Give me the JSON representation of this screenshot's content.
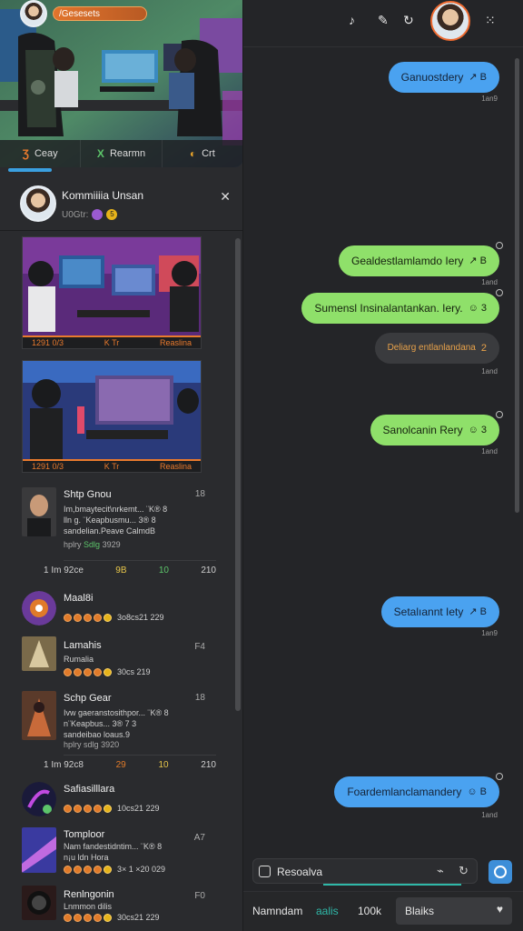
{
  "hero": {
    "pill_label": "/Gesesets",
    "tabs": [
      {
        "icon": "Ʒ",
        "label": "Ceay"
      },
      {
        "icon": "X",
        "label": "Rearmn"
      },
      {
        "icon": "◐",
        "label": "Crt"
      }
    ]
  },
  "profile": {
    "name": "Kommiiiia Unsan",
    "sub": "U0Gtr:",
    "badge": "5"
  },
  "media": [
    {
      "left": "1291 0/3",
      "mid": "K Tr",
      "right": "Reaslina"
    },
    {
      "left": "1291 0/3",
      "mid": "K Tr",
      "right": "Reaslina"
    }
  ],
  "posts": [
    {
      "title": "Shtp Gnou",
      "time": "18",
      "lines": [
        "Im,bmaytecit\\nrkemt... ¨K® 8",
        "lln g. ¨Keapbusmu... 3® 8",
        "sandelian.Peave CalmdB"
      ],
      "meta_a": "hplry",
      "meta_b": "Sdlg",
      "meta_c": "3929",
      "stats": [
        "1 Im 92ce",
        "9B",
        "10",
        "210"
      ]
    },
    {
      "title": "Schp Gear",
      "time": "18",
      "lines": [
        "Ivw gaeranstosithpor... ¨K® 8",
        "n¨Keapbus... 3® 7 3",
        "sandeibao loaus.9"
      ],
      "meta_a": "hplry",
      "meta_b": "sdlg",
      "meta_c": "3920",
      "stats": [
        "1 Im 92c8",
        "29",
        "10",
        "210"
      ]
    }
  ],
  "list": [
    {
      "title": "Maal8i",
      "sub": "3o8cs21 229",
      "time": ""
    },
    {
      "title": "Lamahis",
      "sub2": "Rumalia",
      "sub": "30cs 219",
      "time": "F4"
    },
    {
      "title": "Safiasilllara",
      "sub": "10cs21 229",
      "time": ""
    },
    {
      "title": "Tomploor",
      "sub2": "Nam fandestidntim... ¨K® 8",
      "sub3": "n¡u ldn Hora",
      "sub": "3× 1 ×20 029",
      "time": "A7"
    },
    {
      "title": "Renlngonin",
      "sub2": "Lnmmon dilis",
      "sub": "30cs21 229",
      "time": "F0"
    }
  ],
  "messages": [
    {
      "text": "Ganuostdery",
      "emoji": "↗ B",
      "ts": "1an9",
      "color": "blue"
    },
    {
      "text": "Gealdestlamlamdo Iery",
      "emoji": "↗ B",
      "ts": "1and",
      "color": "green"
    },
    {
      "text": "Sumensl Insinalantankan. Iery.",
      "emoji": "☺ 3",
      "ts": "",
      "color": "green"
    },
    {
      "text": "Deliarg entlanlandana",
      "emoji": "2",
      "ts": "1and",
      "color": "grey"
    },
    {
      "text": "Sanolcanin Rery",
      "emoji": "☺ 3",
      "ts": "1and",
      "color": "green"
    },
    {
      "text": "Setalıannt Iety",
      "emoji": "↗ B",
      "ts": "1an9",
      "color": "blue"
    },
    {
      "text": "Foardemlanclamandery",
      "emoji": "☺ B",
      "ts": "1and",
      "color": "blue"
    }
  ],
  "composer": {
    "value": "Resoalva"
  },
  "bottom": {
    "item1": "Namndam",
    "item2": "aalis",
    "item3": "100k",
    "search_value": "Blaiks"
  },
  "colors": {
    "accent_blue": "#4aa2f0",
    "accent_green": "#8fe06a",
    "orange": "#e97a2d"
  }
}
